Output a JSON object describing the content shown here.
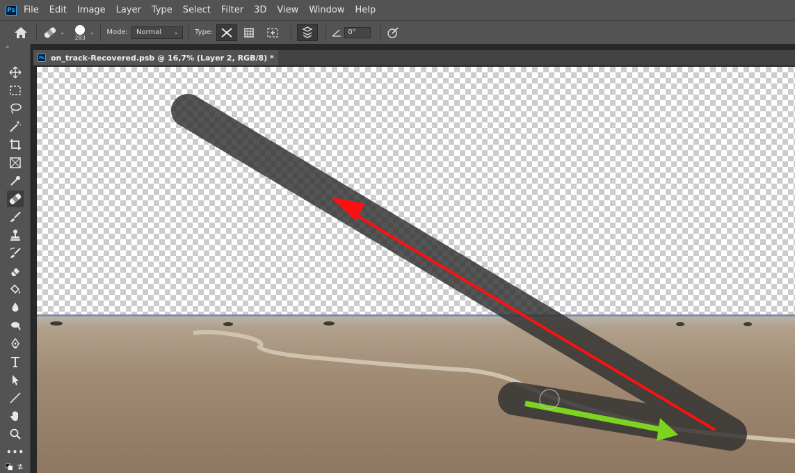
{
  "menubar": {
    "logo": "Ps",
    "items": [
      "File",
      "Edit",
      "Image",
      "Layer",
      "Type",
      "Select",
      "Filter",
      "3D",
      "View",
      "Window",
      "Help"
    ]
  },
  "options_bar": {
    "home_icon": "home-icon",
    "tool_preset_icon": "healing-brush-icon",
    "brush_size": "283",
    "mode_label": "Mode:",
    "mode_value": "Normal",
    "type_label": "Type:",
    "type_buttons": [
      "content-aware-icon",
      "create-texture-icon",
      "proximity-match-icon"
    ],
    "sample_all_layers_icon": "sample-all-layers-icon",
    "angle_icon": "angle-icon",
    "angle_value": "0°",
    "pressure_icon": "pressure-icon"
  },
  "toolbar": {
    "collapse_label": "»",
    "tools": [
      "move-tool-icon",
      "marquee-tool-icon",
      "lasso-tool-icon",
      "magic-wand-tool-icon",
      "crop-tool-icon",
      "frame-tool-icon",
      "eyedropper-tool-icon",
      "spot-healing-brush-icon",
      "brush-tool-icon",
      "clone-stamp-icon",
      "history-brush-icon",
      "eraser-tool-icon",
      "paint-bucket-icon",
      "blur-tool-icon",
      "dodge-tool-icon",
      "pen-tool-icon",
      "type-tool-icon",
      "path-selection-icon",
      "line-tool-icon",
      "hand-tool-icon",
      "zoom-tool-icon",
      "more-tools-icon"
    ],
    "active_tool": "spot-healing-brush-icon",
    "more_label": "•••"
  },
  "document": {
    "tab_icon": "Ps",
    "title": "on_track-Recovered.psb @ 16,7% (Layer 2, RGB/8) *"
  },
  "colors": {
    "panel_bg": "#535353",
    "app_bg": "#282828",
    "brush_stroke": "#2f2f2f",
    "red_arrow": "#ff1010",
    "green_arrow": "#7ed321",
    "horizon_line": "#7e8ea8"
  }
}
